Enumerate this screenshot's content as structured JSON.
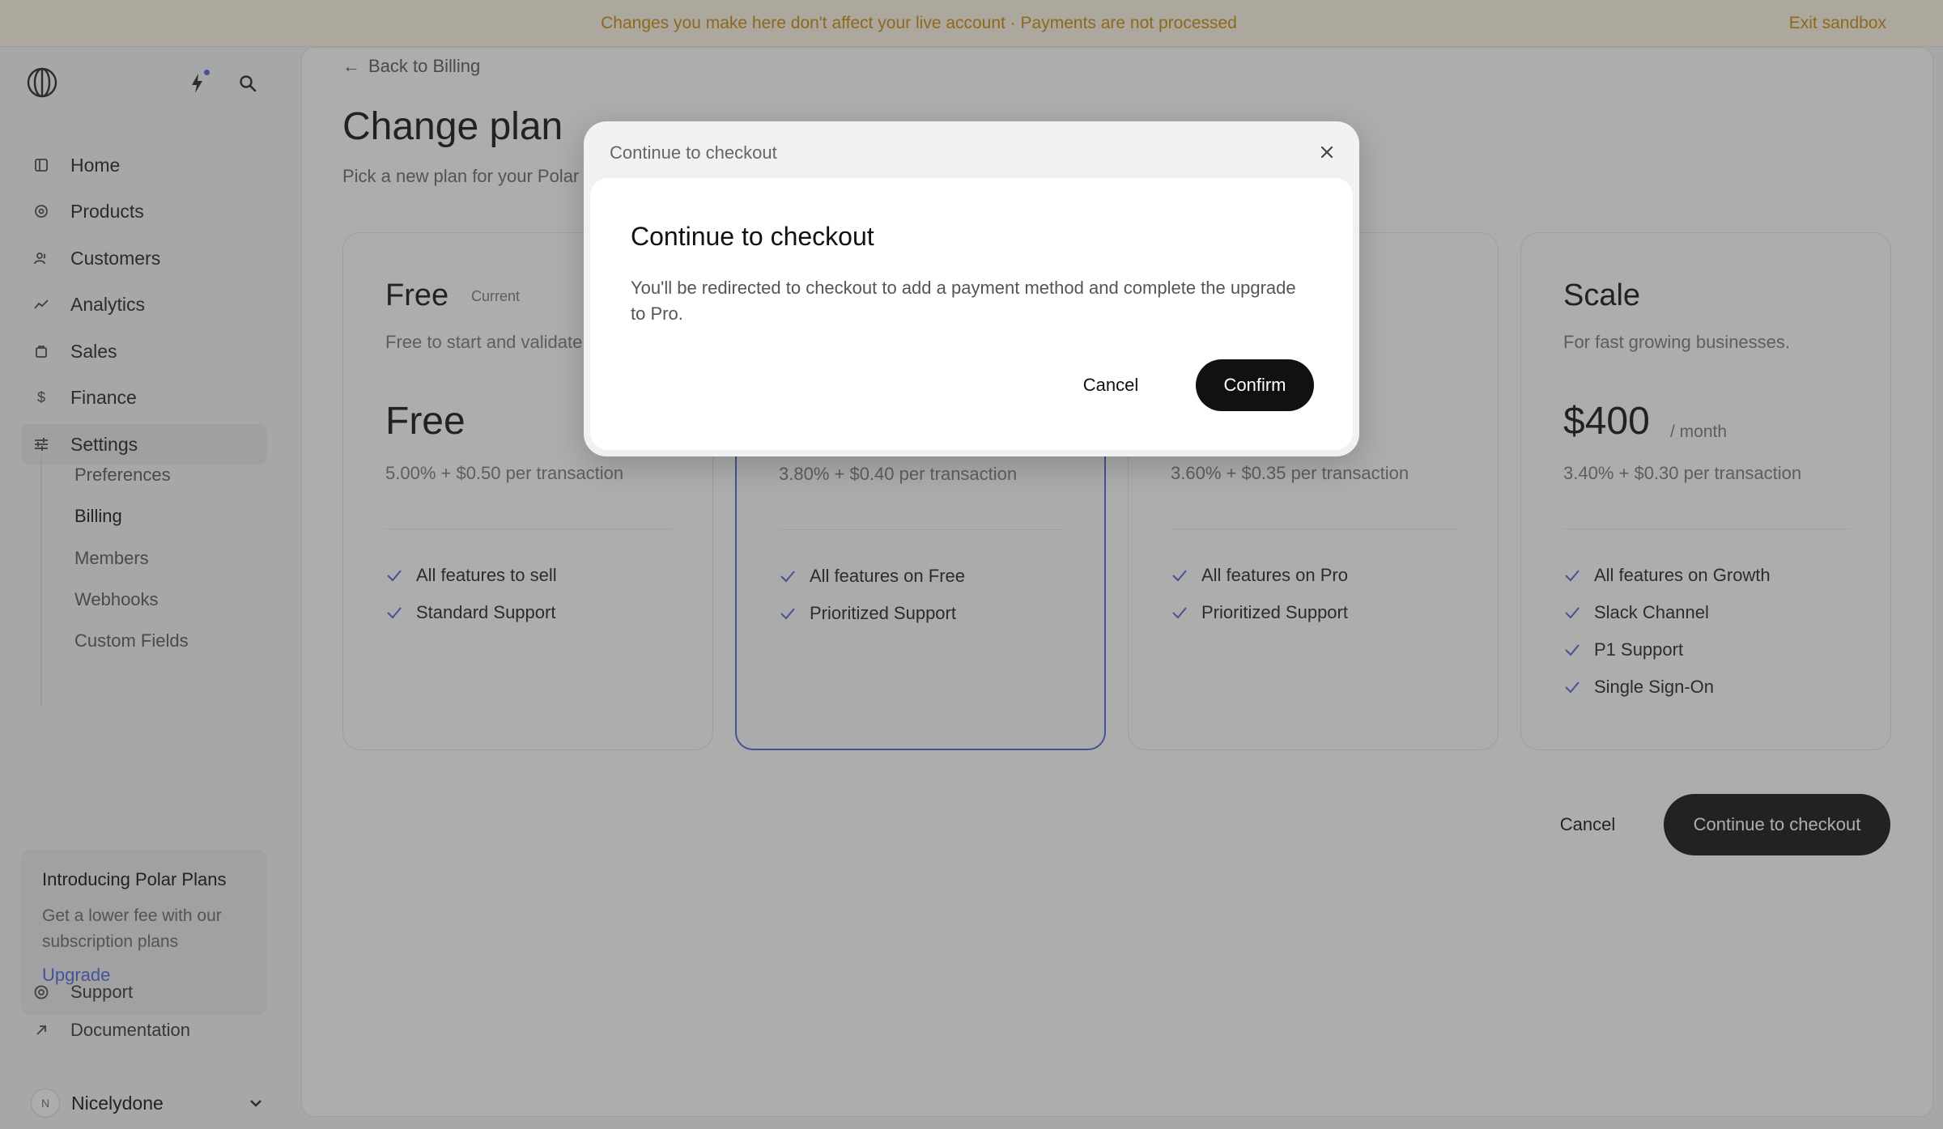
{
  "banner": {
    "message": "Changes you make here don't affect your live account · Payments are not processed",
    "exit_label": "Exit sandbox"
  },
  "sidebar": {
    "items": [
      {
        "label": "Home",
        "icon": "home-icon"
      },
      {
        "label": "Products",
        "icon": "products-icon"
      },
      {
        "label": "Customers",
        "icon": "customers-icon"
      },
      {
        "label": "Analytics",
        "icon": "analytics-icon"
      },
      {
        "label": "Sales",
        "icon": "sales-icon"
      },
      {
        "label": "Finance",
        "icon": "finance-icon"
      },
      {
        "label": "Settings",
        "icon": "settings-icon"
      }
    ],
    "settings_sub": [
      "Preferences",
      "Billing",
      "Members",
      "Webhooks",
      "Custom Fields"
    ],
    "promo": {
      "title": "Introducing Polar Plans",
      "text": "Get a lower fee with our subscription plans",
      "link": "Upgrade"
    },
    "footer": [
      {
        "label": "Support",
        "icon": "support-icon"
      },
      {
        "label": "Documentation",
        "icon": "external-link-icon"
      }
    ],
    "account": {
      "initial": "N",
      "name": "Nicelydone"
    }
  },
  "main": {
    "back_label": "Back to Billing",
    "title": "Change plan",
    "subtitle": "Pick a new plan for your Polar s",
    "plans": [
      {
        "name": "Free",
        "badge": "Current",
        "desc": "Free to start and validate",
        "price": "Free",
        "period": "",
        "fee": "5.00% + $0.50 per transaction",
        "features": [
          "All features to sell",
          "Standard Support"
        ]
      },
      {
        "name": "",
        "badge": "",
        "desc": "",
        "price": "",
        "period": "",
        "fee": "3.80% + $0.40 per transaction",
        "features": [
          "All features on Free",
          "Prioritized Support"
        ]
      },
      {
        "name": "",
        "badge": "",
        "desc": "",
        "price": "",
        "period": "",
        "fee": "3.60% + $0.35 per transaction",
        "features": [
          "All features on Pro",
          "Prioritized Support"
        ]
      },
      {
        "name": "Scale",
        "badge": "",
        "desc": "For fast growing businesses.",
        "price": "$400",
        "period": "/ month",
        "fee": "3.40% + $0.30 per transaction",
        "features": [
          "All features on Growth",
          "Slack Channel",
          "P1 Support",
          "Single Sign-On"
        ]
      }
    ],
    "cancel_label": "Cancel",
    "checkout_label": "Continue to checkout"
  },
  "modal": {
    "header": "Continue to checkout",
    "title": "Continue to checkout",
    "text": "You'll be redirected to checkout to add a payment method and complete the upgrade to Pro.",
    "cancel_label": "Cancel",
    "confirm_label": "Confirm"
  },
  "colors": {
    "accent": "#4f63d8",
    "banner_text": "#c98a09",
    "primary_button": "#111111"
  }
}
